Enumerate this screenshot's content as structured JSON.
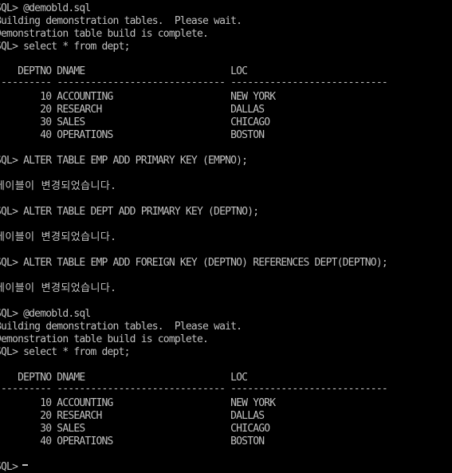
{
  "console": {
    "lines": [
      "SQL> @demobld.sql",
      "Building demonstration tables.  Please wait.",
      "Demonstration table build is complete.",
      "SQL> select * from dept;",
      "",
      "    DEPTNO DNAME                          LOC",
      "---------- ------------------------------ ----------------------------",
      "",
      "        10 ACCOUNTING                     NEW YORK",
      "        20 RESEARCH                       DALLAS",
      "        30 SALES                          CHICAGO",
      "        40 OPERATIONS                     BOSTON",
      "",
      "SQL> ALTER TABLE EMP ADD PRIMARY KEY (EMPNO);",
      "",
      "테이블이 변경되었습니다.",
      "",
      "SQL> ALTER TABLE DEPT ADD PRIMARY KEY (DEPTNO);",
      "",
      "테이블이 변경되었습니다.",
      "",
      "SQL> ALTER TABLE EMP ADD FOREIGN KEY (DEPTNO) REFERENCES DEPT(DEPTNO);",
      "",
      "테이블이 변경되었습니다.",
      "",
      "SQL> @demobld.sql",
      "Building demonstration tables.  Please wait.",
      "Demonstration table build is complete.",
      "SQL> select * from dept;",
      "",
      "    DEPTNO DNAME                          LOC",
      "---------- ------------------------------ ----------------------------",
      "",
      "        10 ACCOUNTING                     NEW YORK",
      "        20 RESEARCH                       DALLAS",
      "        30 SALES                          CHICAGO",
      "        40 OPERATIONS                     BOSTON",
      "",
      "SQL>"
    ]
  }
}
